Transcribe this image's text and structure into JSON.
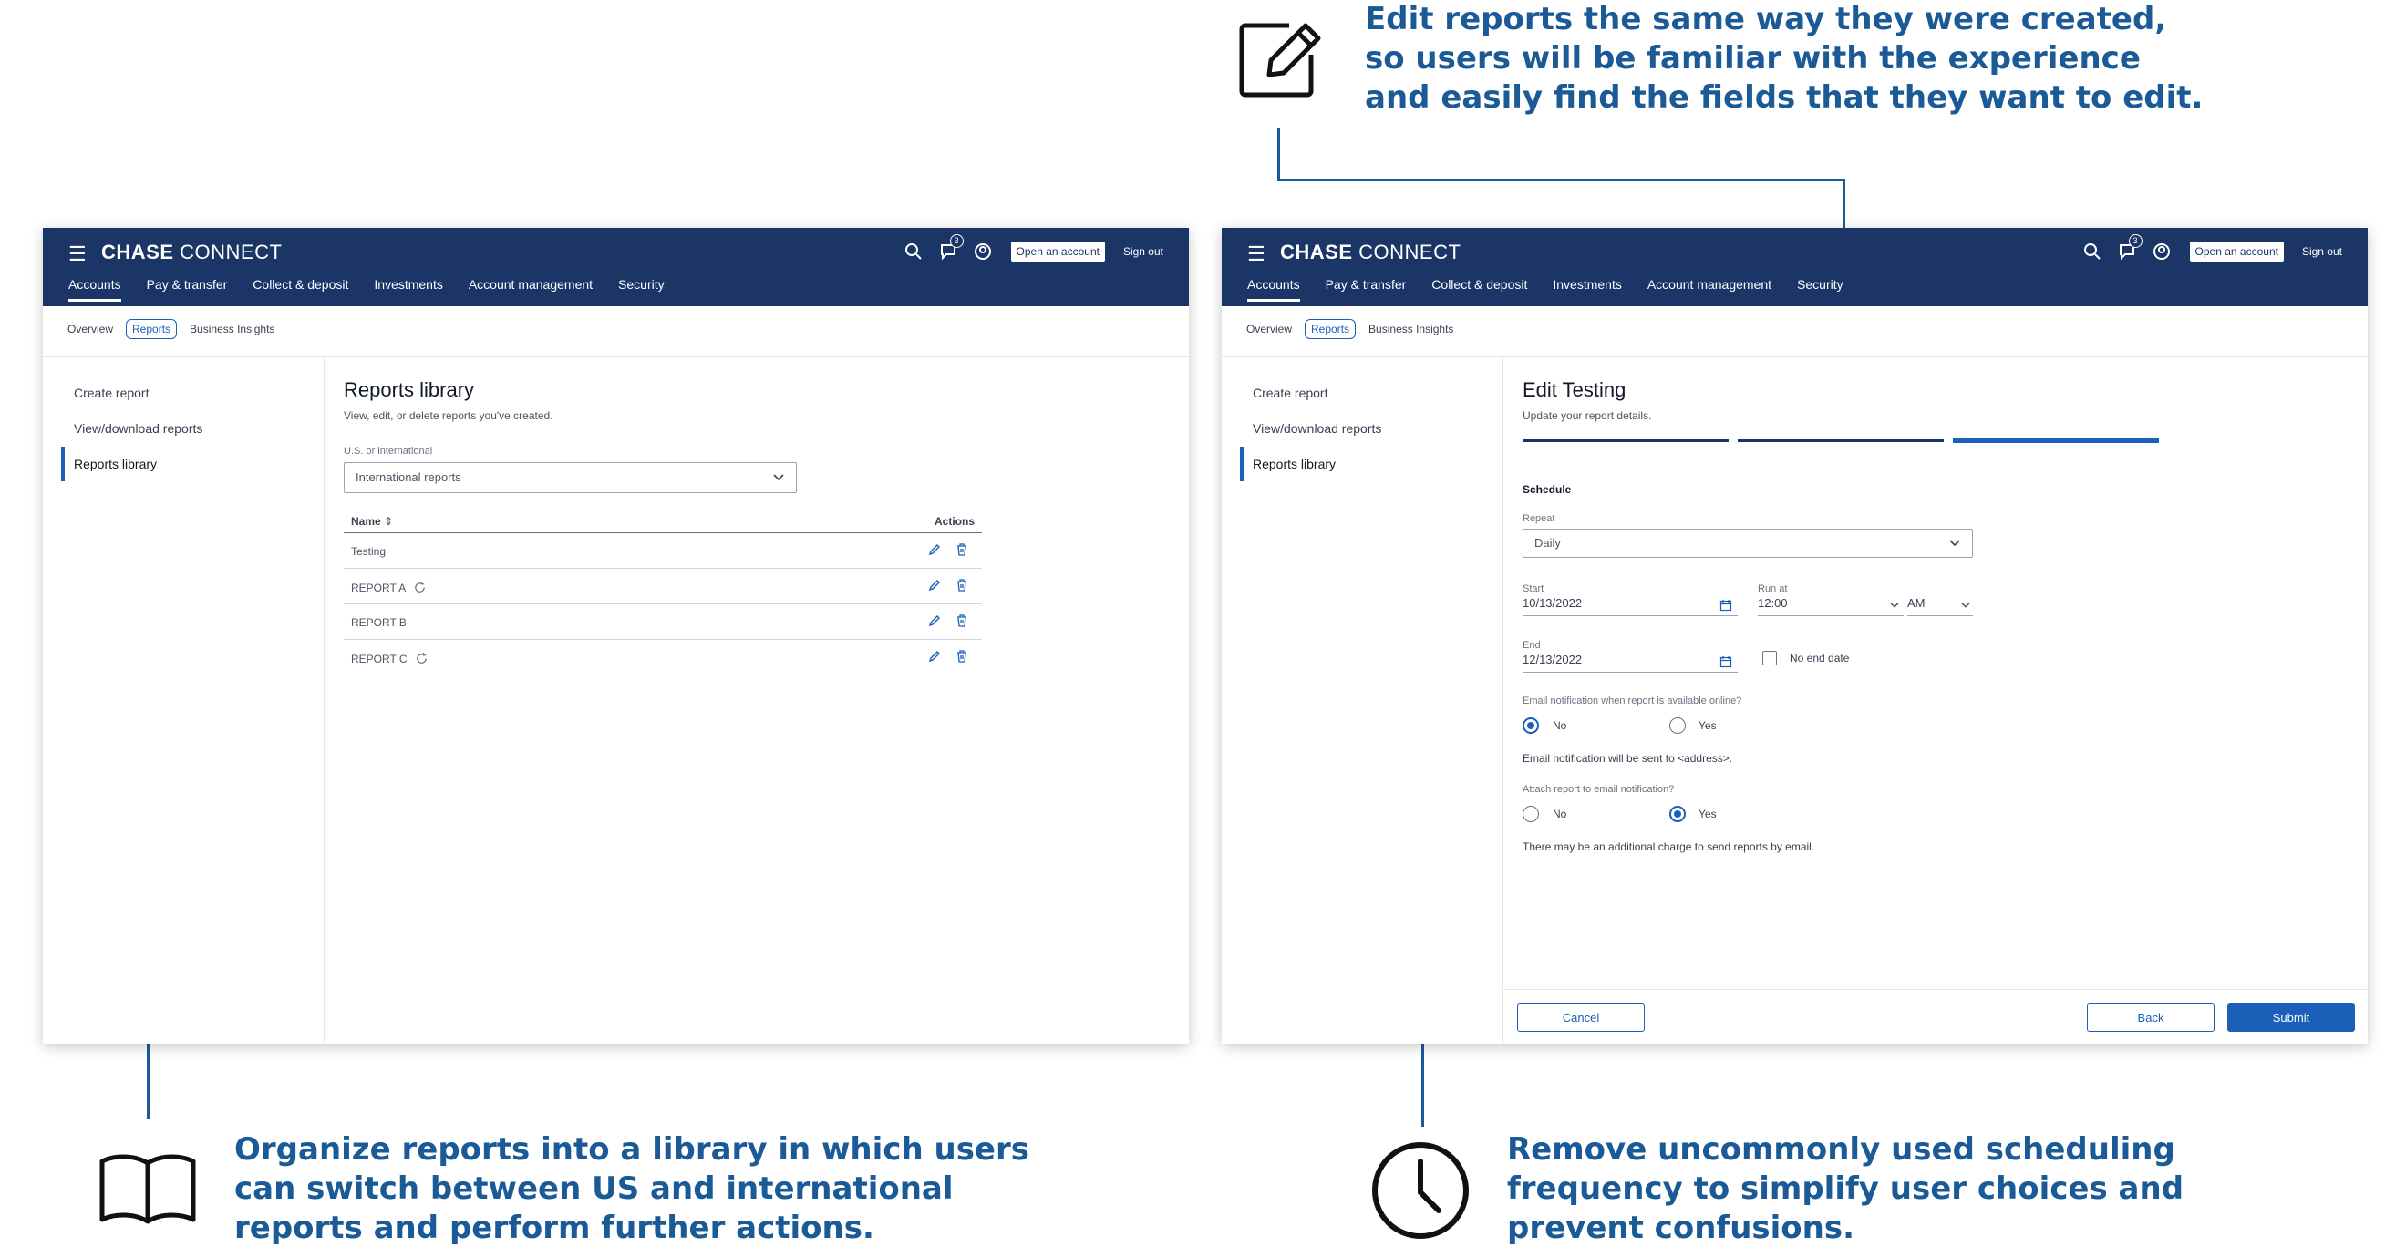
{
  "annotations": {
    "top": [
      "Edit reports the same way they were created,",
      "so users will be familiar with the experience",
      "and easily find the fields that they want to edit."
    ],
    "bottom_left": [
      "Organize reports into a library in which users",
      "can switch between US and international",
      "reports and perform further actions."
    ],
    "bottom_right": [
      "Remove uncommonly used scheduling",
      "frequency to simplify user choices and",
      "prevent confusions."
    ]
  },
  "header": {
    "brand_bold": "CHASE",
    "brand_light": "CONNECT",
    "notification_count": "3",
    "open_account": "Open an account",
    "sign_out": "Sign out",
    "nav": [
      "Accounts",
      "Pay & transfer",
      "Collect & deposit",
      "Investments",
      "Account management",
      "Security"
    ]
  },
  "subnav": [
    "Overview",
    "Reports",
    "Business Insights"
  ],
  "sidebar": [
    "Create report",
    "View/download reports",
    "Reports library"
  ],
  "library": {
    "title": "Reports library",
    "subtitle": "View, edit, or delete reports you've created.",
    "filter_label": "U.S. or international",
    "filter_value": "International reports",
    "col_name": "Name",
    "col_actions": "Actions",
    "rows": [
      {
        "name": "Testing"
      },
      {
        "name": "REPORT A"
      },
      {
        "name": "REPORT B"
      },
      {
        "name": "REPORT C"
      }
    ]
  },
  "edit": {
    "title": "Edit Testing",
    "subtitle": "Update your report details.",
    "section": "Schedule",
    "repeat_label": "Repeat",
    "repeat_value": "Daily",
    "start_label": "Start",
    "start_value": "10/13/2022",
    "run_label": "Run at",
    "run_value": "12:00",
    "ampm_value": "AM",
    "end_label": "End",
    "end_value": "12/13/2022",
    "no_end": "No end date",
    "email_q": "Email notification when report is available online?",
    "no": "No",
    "yes": "Yes",
    "email_note": "Email notification will be sent to <address>.",
    "attach_q": "Attach report to email notification?",
    "charge_note": "There may be an additional charge to send reports by email.",
    "cancel": "Cancel",
    "back": "Back",
    "submit": "Submit"
  }
}
